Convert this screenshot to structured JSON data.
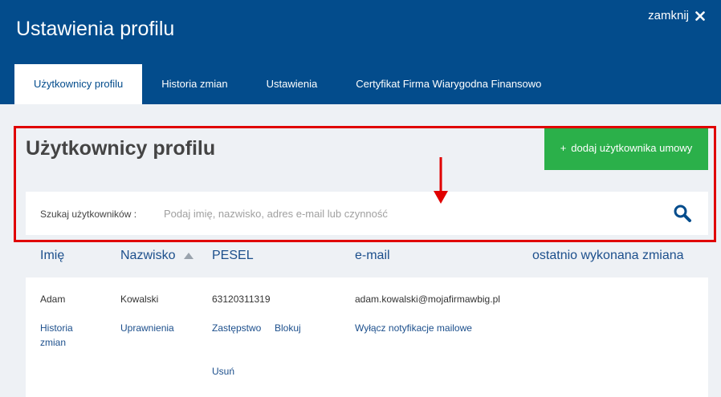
{
  "window": {
    "title": "Ustawienia profilu",
    "close_label": "zamknij"
  },
  "tabs": [
    {
      "label": "Użytkownicy profilu",
      "active": true
    },
    {
      "label": "Historia zmian",
      "active": false
    },
    {
      "label": "Ustawienia",
      "active": false
    },
    {
      "label": "Certyfikat Firma Wiarygodna Finansowo",
      "active": false
    }
  ],
  "main": {
    "title": "Użytkownicy profilu",
    "add_button": {
      "plus": "+",
      "label": "dodaj użytkownika umowy"
    },
    "search": {
      "label": "Szukaj użytkowników :",
      "placeholder": "Podaj imię, nazwisko, adres e-mail lub czynność"
    }
  },
  "table": {
    "columns": [
      "Imię",
      "Nazwisko",
      "PESEL",
      "e-mail",
      "ostatnio wykonana zmiana"
    ],
    "sorted_column": "Nazwisko",
    "sort_direction": "ascending",
    "rows": [
      {
        "first_name": "Adam",
        "last_name": "Kowalski",
        "pesel": "63120311319",
        "email": "adam.kowalski@mojafirmawbig.pl",
        "last_change": "",
        "actions": {
          "history": "Historia zmian",
          "permissions": "Uprawnienia",
          "substitute": "Zastępstwo",
          "block": "Blokuj",
          "delete": "Usuń",
          "disable_notifications": "Wyłącz notyfikacje mailowe"
        }
      }
    ]
  },
  "colors": {
    "header_bg": "#034c8c",
    "accent_green": "#2bb04a",
    "link_blue": "#1c4f8c",
    "annotation_red": "#e00000",
    "page_bg": "#eef1f5"
  },
  "icons": {
    "close": "close-icon",
    "search": "search-icon",
    "sort": "sort-ascending-icon",
    "annotation_arrow": "arrow-down-icon"
  }
}
